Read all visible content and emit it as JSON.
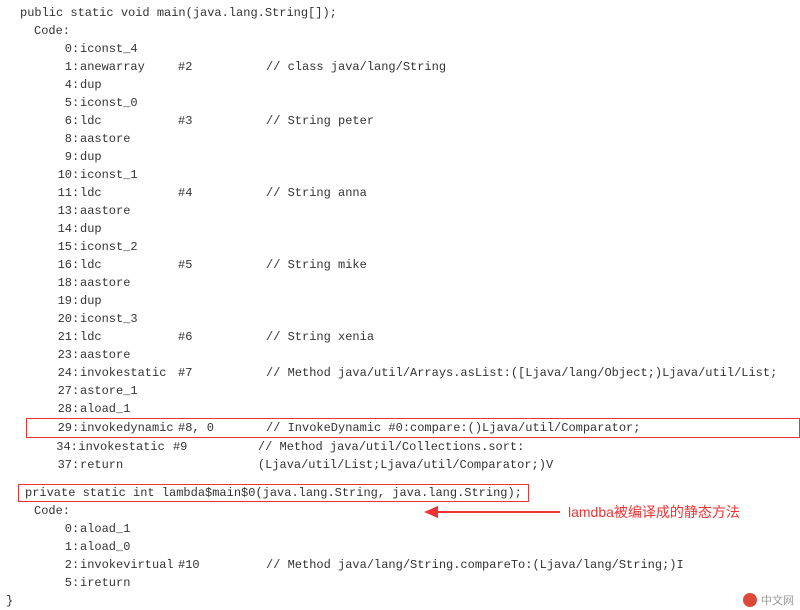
{
  "method1": {
    "signature": "public static void main(java.lang.String[]);",
    "code_label": "Code:",
    "rows": [
      {
        "o": "0",
        "op": "iconst_4",
        "arg": "",
        "c": ""
      },
      {
        "o": "1",
        "op": "anewarray",
        "arg": "#2",
        "c": "// class java/lang/String"
      },
      {
        "o": "4",
        "op": "dup",
        "arg": "",
        "c": ""
      },
      {
        "o": "5",
        "op": "iconst_0",
        "arg": "",
        "c": ""
      },
      {
        "o": "6",
        "op": "ldc",
        "arg": "#3",
        "c": "// String peter"
      },
      {
        "o": "8",
        "op": "aastore",
        "arg": "",
        "c": ""
      },
      {
        "o": "9",
        "op": "dup",
        "arg": "",
        "c": ""
      },
      {
        "o": "10",
        "op": "iconst_1",
        "arg": "",
        "c": ""
      },
      {
        "o": "11",
        "op": "ldc",
        "arg": "#4",
        "c": "// String anna"
      },
      {
        "o": "13",
        "op": "aastore",
        "arg": "",
        "c": ""
      },
      {
        "o": "14",
        "op": "dup",
        "arg": "",
        "c": ""
      },
      {
        "o": "15",
        "op": "iconst_2",
        "arg": "",
        "c": ""
      },
      {
        "o": "16",
        "op": "ldc",
        "arg": "#5",
        "c": "// String mike"
      },
      {
        "o": "18",
        "op": "aastore",
        "arg": "",
        "c": ""
      },
      {
        "o": "19",
        "op": "dup",
        "arg": "",
        "c": ""
      },
      {
        "o": "20",
        "op": "iconst_3",
        "arg": "",
        "c": ""
      },
      {
        "o": "21",
        "op": "ldc",
        "arg": "#6",
        "c": "// String xenia"
      },
      {
        "o": "23",
        "op": "aastore",
        "arg": "",
        "c": ""
      },
      {
        "o": "24",
        "op": "invokestatic",
        "arg": "#7",
        "c": "// Method java/util/Arrays.asList:([Ljava/lang/Object;)Ljava/util/List;"
      },
      {
        "o": "27",
        "op": "astore_1",
        "arg": "",
        "c": ""
      },
      {
        "o": "28",
        "op": "aload_1",
        "arg": "",
        "c": ""
      },
      {
        "o": "29",
        "op": "invokedynamic",
        "arg": "#8,  0",
        "c": "// InvokeDynamic #0:compare:()Ljava/util/Comparator;",
        "hl": true
      },
      {
        "o": "34",
        "op": "invokestatic",
        "arg": "#9",
        "c": "// Method java/util/Collections.sort:(Ljava/util/List;Ljava/util/Comparator;)V"
      },
      {
        "o": "37",
        "op": "return",
        "arg": "",
        "c": ""
      }
    ]
  },
  "method2": {
    "signature": "private static int lambda$main$0(java.lang.String, java.lang.String);",
    "code_label": "Code:",
    "rows": [
      {
        "o": "0",
        "op": "aload_1",
        "arg": "",
        "c": ""
      },
      {
        "o": "1",
        "op": "aload_0",
        "arg": "",
        "c": ""
      },
      {
        "o": "2",
        "op": "invokevirtual",
        "arg": "#10",
        "c": "// Method java/lang/String.compareTo:(Ljava/lang/String;)I"
      },
      {
        "o": "5",
        "op": "ireturn",
        "arg": "",
        "c": ""
      }
    ]
  },
  "close_brace": "}",
  "annotation": "lamdba被编译成的静态方法",
  "watermark": "中文网"
}
